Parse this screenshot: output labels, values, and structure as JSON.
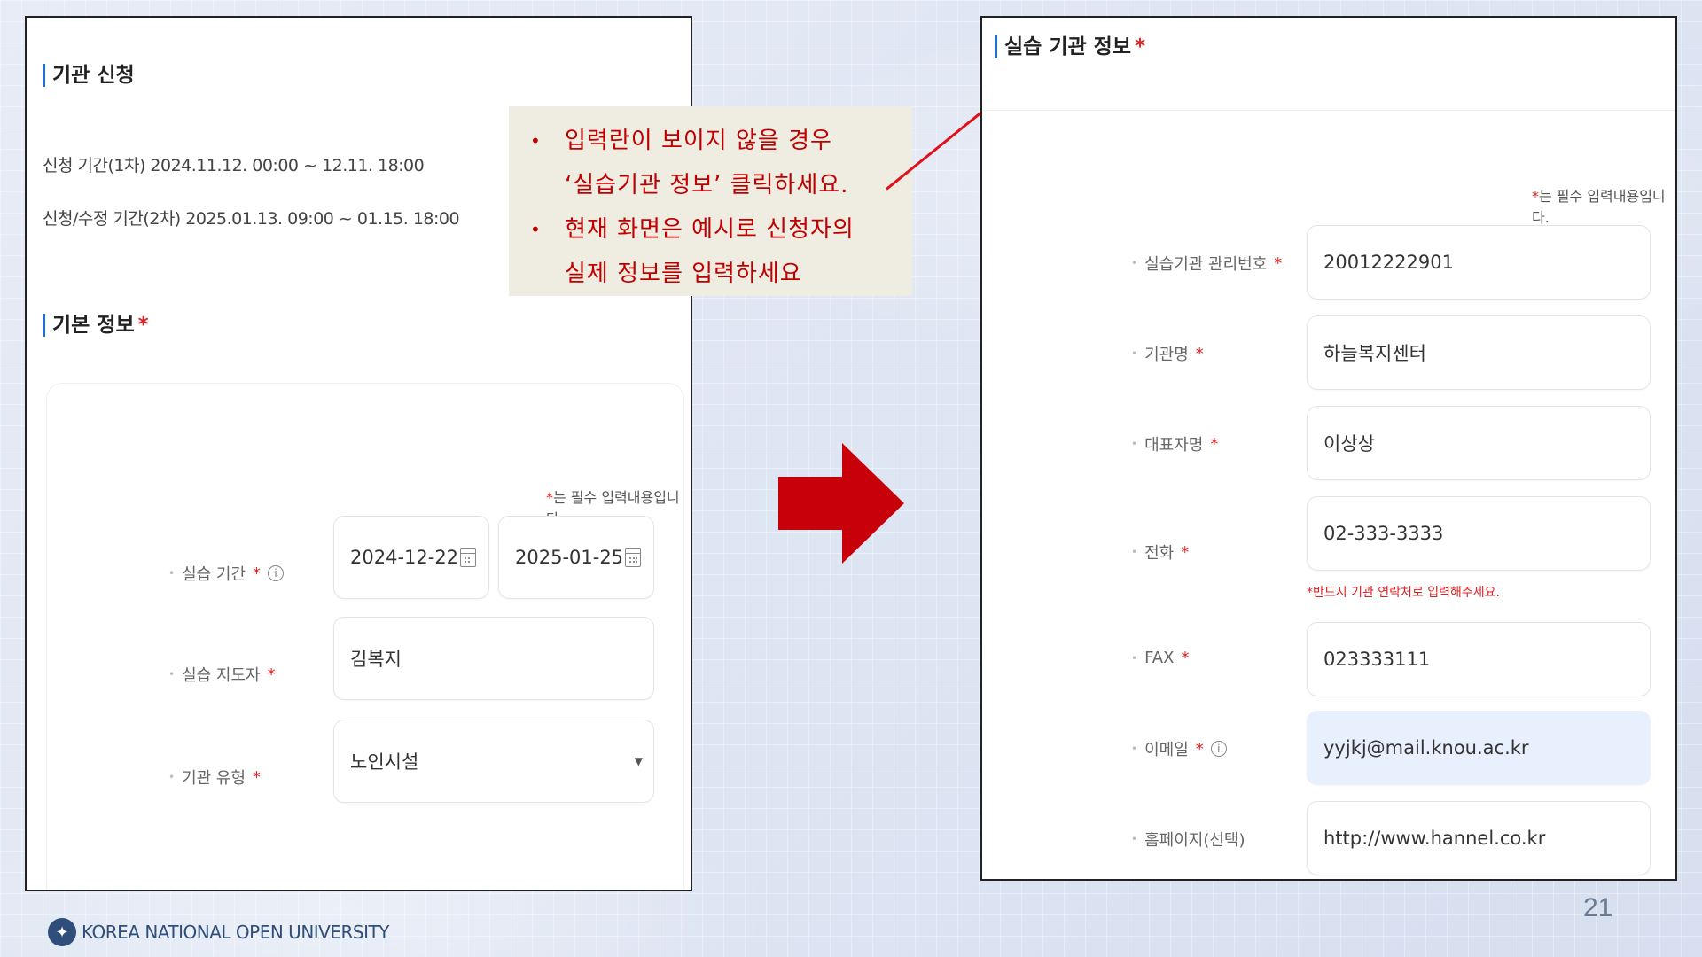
{
  "left_panel": {
    "title": "기관 신청",
    "period1": "신청 기간(1차) 2024.11.12. 00:00 ~ 12.11. 18:00",
    "period2": "신청/수정 기간(2차) 2025.01.13. 09:00 ~ 01.15. 18:00",
    "section_title": "기본 정보",
    "required_star": "*",
    "req_note": "는 필수 입력내용입니다.",
    "fields": {
      "period_label": "실습 기간",
      "start_date": "2024-12-22",
      "end_date": "2025-01-25",
      "supervisor_label": "실습 지도자",
      "supervisor_value": "김복지",
      "type_label": "기관 유형",
      "type_value": "노인시설"
    }
  },
  "callout": {
    "items": [
      "입력란이 보이지 않을 경우",
      "‘실습기관 정보’ 클릭하세요.",
      "현재 화면은 예시로 신청자의",
      "실제 정보를 입력하세요"
    ],
    "bullet": "•"
  },
  "right_panel": {
    "title": "실습 기관 정보",
    "required_star": "*",
    "req_note": "는 필수 입력내용입니다.",
    "fields": {
      "mgmt_no_label": "실습기관 관리번호",
      "mgmt_no_value": "20012222901",
      "name_label": "기관명",
      "name_value": "하늘복지센터",
      "rep_label": "대표자명",
      "rep_value": "이상상",
      "phone_label": "전화",
      "phone_value": "02-333-3333",
      "phone_warning": "반드시 기관 연락처로 입력해주세요.",
      "fax_label": "FAX",
      "fax_value": "023333111",
      "email_label": "이메일",
      "email_value": "yyjkj@mail.knou.ac.kr",
      "homepage_label": "홈페이지(선택)",
      "homepage_value": "http://www.hannel.co.kr"
    }
  },
  "footer": {
    "logo_text": "KOREA NATIONAL OPEN UNIVERSITY",
    "page_number": "21"
  },
  "colors": {
    "accent_blue": "#1f6fd1",
    "required_red": "#e02020",
    "callout_text": "#c00000",
    "arrow_red": "#c8000a",
    "highlight_field": "#e8f0fe"
  },
  "icons": [
    "calendar-icon",
    "info-icon",
    "dropdown-caret-icon",
    "university-logo-icon"
  ]
}
